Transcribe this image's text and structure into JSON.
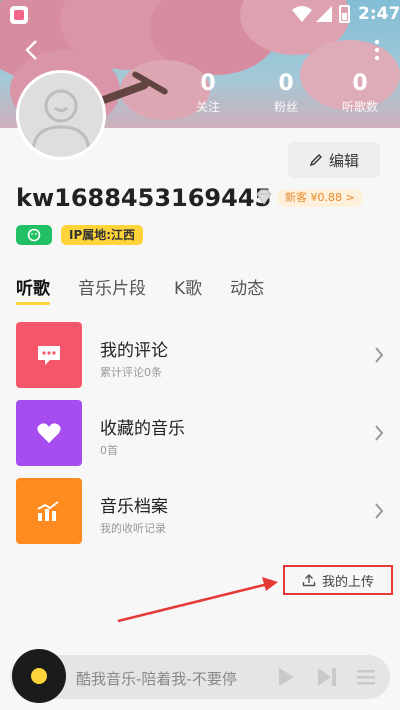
{
  "status_bar": {
    "time": "2:47"
  },
  "profile": {
    "stats": [
      {
        "count": "0",
        "label": "关注"
      },
      {
        "count": "0",
        "label": "粉丝"
      },
      {
        "count": "0",
        "label": "听歌数"
      }
    ],
    "edit_label": "编辑",
    "username": "kw1688453169445",
    "newbie_badge": "新客 ¥0.88 >",
    "ip_tag": "IP属地:江西"
  },
  "tabs": [
    {
      "label": "听歌",
      "active": true
    },
    {
      "label": "音乐片段",
      "active": false
    },
    {
      "label": "K歌",
      "active": false
    },
    {
      "label": "动态",
      "active": false
    }
  ],
  "cards": [
    {
      "title": "我的评论",
      "subtitle": "累计评论0条",
      "icon": "comment-icon",
      "color": "#f5566a"
    },
    {
      "title": "收藏的音乐",
      "subtitle": "0首",
      "icon": "heart-icon",
      "color": "#a64df0"
    },
    {
      "title": "音乐档案",
      "subtitle": "我的收听记录",
      "icon": "chart-icon",
      "color": "#ff8a1f"
    }
  ],
  "upload": {
    "label": "我的上传"
  },
  "player": {
    "song_text": "酷我音乐-陪着我-不要停"
  },
  "colors": {
    "accent_yellow": "#ffd43b",
    "annotation_red": "#e53935"
  }
}
